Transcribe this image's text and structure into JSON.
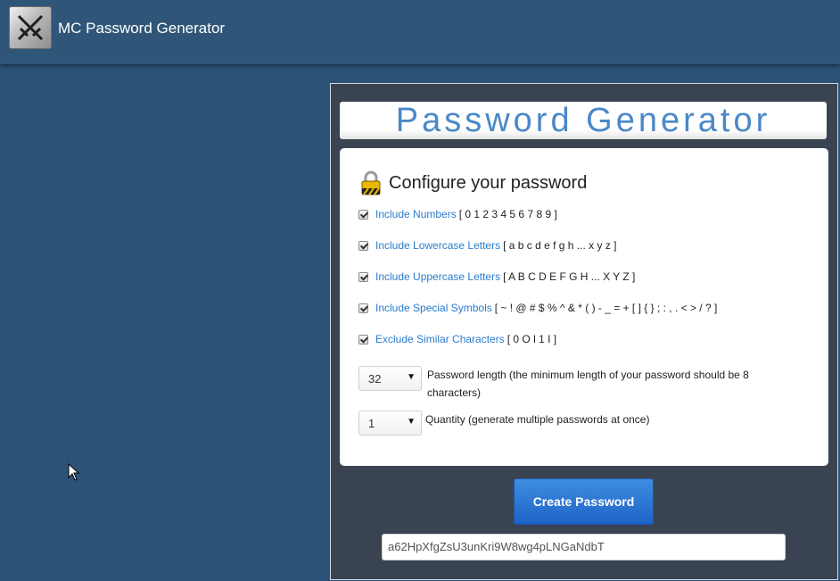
{
  "app": {
    "title": "MC Password Generator"
  },
  "header": {
    "title": "Password Generator"
  },
  "card": {
    "heading": "Configure your password",
    "options": [
      {
        "label": "Include Numbers",
        "detail": "[ 0 1 2 3 4 5 6 7 8 9 ]",
        "checked": true
      },
      {
        "label": "Include Lowercase Letters",
        "detail": "[ a b c d e f g h ... x y z ]",
        "checked": true
      },
      {
        "label": "Include Uppercase Letters",
        "detail": "[ A B C D E F G H ... X Y Z ]",
        "checked": true
      },
      {
        "label": "Include Special Symbols",
        "detail": "[ ~ ! @ # $ % ^ & * ( ) - _ = + [ ] { } ; : , . < > / ? ]",
        "checked": true
      },
      {
        "label": "Exclude Similar Characters",
        "detail": "[ 0 O l 1 I ]",
        "checked": true
      }
    ],
    "length": {
      "value": "32",
      "label": "Password length (the minimum length of your password should be 8 characters)"
    },
    "quantity": {
      "value": "1",
      "label": "Quantity (generate multiple passwords at once)"
    }
  },
  "actions": {
    "create_label": "Create Password"
  },
  "result": {
    "value": "a62HpXfgZsU3unKri9W8wg4pLNGaNdbT"
  },
  "colors": {
    "background": "#2d5278",
    "panel": "#3a4352",
    "link": "#2a7ccc",
    "title": "#4a88c9",
    "button": "#2a74d4"
  }
}
